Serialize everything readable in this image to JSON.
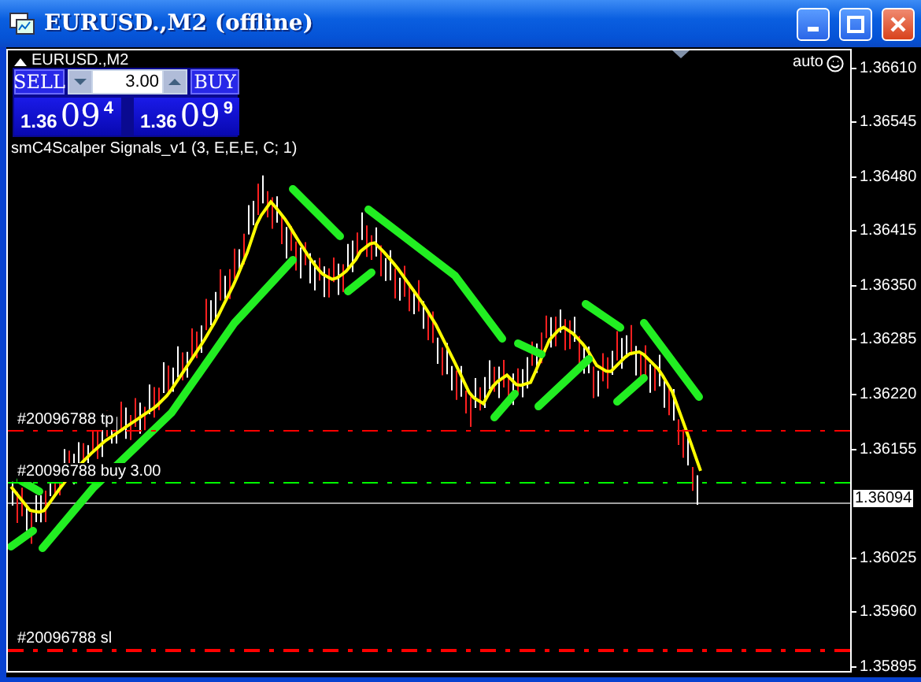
{
  "window": {
    "title": "EURUSD.,M2 (offline)"
  },
  "chart": {
    "symbol_label": "EURUSD.,M2",
    "indicator_label": "smC4Scalper Signals_v1 (3, E,E,E, C; 1)",
    "auto_label": "auto",
    "one_click": {
      "sell_label": "SELL",
      "buy_label": "BUY",
      "volume": "3.00",
      "sell_price": {
        "prefix": "1.36",
        "big": "09",
        "sup": "4"
      },
      "buy_price": {
        "prefix": "1.36",
        "big": "09",
        "sup": "9"
      }
    },
    "order_lines": [
      {
        "kind": "tp",
        "label": "#20096788 tp",
        "color": "#ff0000"
      },
      {
        "kind": "open",
        "label": "#20096788 buy 3.00",
        "color": "#00ff00"
      },
      {
        "kind": "sl",
        "label": "#20096788 sl",
        "color": "#ff0000"
      }
    ],
    "price_axis": {
      "ticks": [
        "1.36610",
        "1.36545",
        "1.36480",
        "1.36415",
        "1.36350",
        "1.36285",
        "1.36220",
        "1.36155",
        "1.36025",
        "1.35960",
        "1.35895"
      ],
      "current_price": "1.36094"
    }
  }
}
